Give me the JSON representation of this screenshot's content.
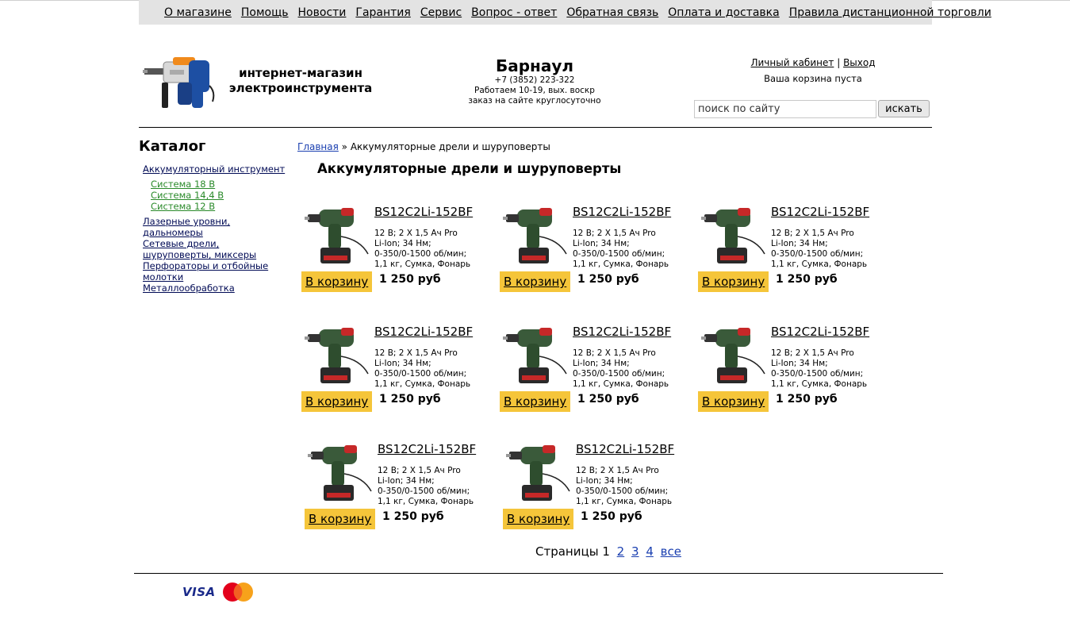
{
  "topnav": {
    "items": [
      "О магазине",
      "Помощь",
      "Новости",
      "Гарантия",
      "Сервис",
      "Вопрос - ответ",
      "Обратная связь",
      "Оплата и доставка",
      "Правила дистанционной торговли"
    ]
  },
  "header": {
    "slogan_line1": "интернет-магазин",
    "slogan_line2": "электроинструмента",
    "city": "Барнаул",
    "phone": "+7 (3852) 223-322",
    "hours": "Работаем 10-19, вых. воскр",
    "order_note": "заказ на сайте круглосуточно",
    "account_link": "Личный кабинет",
    "separator": "|",
    "logout_link": "Выход",
    "cart_status": "Ваша корзина пуста",
    "search_placeholder": "поиск по сайту",
    "search_button": "искать"
  },
  "sidebar": {
    "title": "Каталог",
    "items": [
      {
        "label": "Аккумуляторный инструмент"
      },
      {
        "label": "Система 18 В",
        "sub": true
      },
      {
        "label": "Система 14,4 В",
        "sub": true
      },
      {
        "label": "Система 12 В",
        "sub": true
      },
      {
        "label": "Лазерные уровни, дальномеры"
      },
      {
        "label": "Сетевые дрели, шуруповерты, миксеры"
      },
      {
        "label": "Перфораторы и отбойные молотки"
      },
      {
        "label": "Металлообработка"
      }
    ]
  },
  "breadcrumb": {
    "home": "Главная",
    "sep": "»",
    "current": "Аккумуляторные дрели и шуруповерты"
  },
  "page_title": "Аккумуляторные дрели и шуруповерты",
  "products": [
    {
      "name": "BS12C2Li-152BF",
      "desc": [
        "12 В; 2 Х 1,5 Ач Pro",
        "Li-Ion; 34 Нм;",
        "0-350/0-1500 об/мин;",
        "1,1 кг, Сумка, Фонарь"
      ],
      "button": "В корзину",
      "price": "1 250 руб"
    },
    {
      "name": "BS12C2Li-152BF",
      "desc": [
        "12 В; 2 Х 1,5 Ач Pro",
        "Li-Ion; 34 Нм;",
        "0-350/0-1500 об/мин;",
        "1,1 кг, Сумка, Фонарь"
      ],
      "button": "В корзину",
      "price": "1 250 руб"
    },
    {
      "name": "BS12C2Li-152BF",
      "desc": [
        "12 В; 2 Х 1,5 Ач Pro",
        "Li-Ion; 34 Нм;",
        "0-350/0-1500 об/мин;",
        "1,1 кг, Сумка, Фонарь"
      ],
      "button": "В корзину",
      "price": "1 250 руб"
    },
    {
      "name": "BS12C2Li-152BF",
      "desc": [
        "12 В; 2 Х 1,5 Ач Pro",
        "Li-Ion; 34 Нм;",
        "0-350/0-1500 об/мин;",
        "1,1 кг, Сумка, Фонарь"
      ],
      "button": "В корзину",
      "price": "1 250 руб"
    },
    {
      "name": "BS12C2Li-152BF",
      "desc": [
        "12 В; 2 Х 1,5 Ач Pro",
        "Li-Ion; 34 Нм;",
        "0-350/0-1500 об/мин;",
        "1,1 кг, Сумка, Фонарь"
      ],
      "button": "В корзину",
      "price": "1 250 руб"
    },
    {
      "name": "BS12C2Li-152BF",
      "desc": [
        "12 В; 2 Х 1,5 Ач Pro",
        "Li-Ion; 34 Нм;",
        "0-350/0-1500 об/мин;",
        "1,1 кг, Сумка, Фонарь"
      ],
      "button": "В корзину",
      "price": "1 250 руб"
    },
    {
      "name": "BS12C2Li-152BF",
      "desc": [
        "12 В; 2 Х 1,5 Ач Pro",
        "Li-Ion; 34 Нм;",
        "0-350/0-1500 об/мин;",
        "1,1 кг, Сумка, Фонарь"
      ],
      "button": "В корзину",
      "price": "1 250 руб"
    },
    {
      "name": "BS12C2Li-152BF",
      "desc": [
        "12 В; 2 Х 1,5 Ач Pro",
        "Li-Ion; 34 Нм;",
        "0-350/0-1500 об/мин;",
        "1,1 кг, Сумка, Фонарь"
      ],
      "button": "В корзину",
      "price": "1 250 руб"
    }
  ],
  "pager": {
    "label": "Страницы",
    "current": "1",
    "pages": [
      "2",
      "3",
      "4"
    ],
    "all": "все"
  },
  "footer": {
    "visa": "VISA",
    "mastercard": "MasterCard"
  },
  "colors": {
    "cart_button": "#f5c53a",
    "nav_bg": "#e3e3e3",
    "sub_link": "#2a8a2a",
    "link": "#1a3fb0"
  }
}
